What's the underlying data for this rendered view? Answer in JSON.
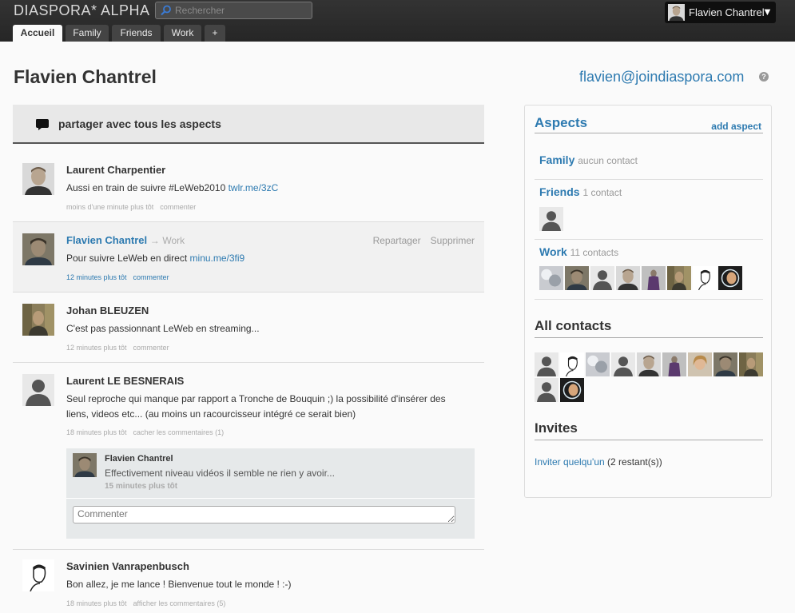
{
  "header": {
    "logo": "DIASPORA* ALPHA",
    "search_placeholder": "Rechercher",
    "user_name": "Flavien Chantrel",
    "user_menu_caret": "▼",
    "tabs": [
      {
        "label": "Accueil",
        "active": true
      },
      {
        "label": "Family",
        "active": false
      },
      {
        "label": "Friends",
        "active": false
      },
      {
        "label": "Work",
        "active": false
      },
      {
        "label": "+",
        "active": false
      }
    ]
  },
  "profile": {
    "name": "Flavien Chantrel",
    "handle": "flavien@joindiaspora.com",
    "help_icon": "?"
  },
  "share": {
    "label": "partager avec tous les aspects",
    "icon": "speech-bubble-icon"
  },
  "posts": [
    {
      "author": "Laurent Charpentier",
      "text": "Aussi en train de suivre #LeWeb2010 ",
      "link": "twlr.me/3zC",
      "time": "moins d'une minute plus tôt",
      "comment_label": "commenter"
    },
    {
      "author": "Flavien Chantrel",
      "aspect_arrow": "→",
      "aspect": "Work",
      "text": "Pour suivre LeWeb en direct ",
      "link": "minu.me/3fi9",
      "time": "12 minutes plus tôt",
      "comment_label": "commenter",
      "actions": [
        "Repartager",
        "Supprimer"
      ]
    },
    {
      "author": "Johan BLEUZEN",
      "text": "C'est pas passionnant LeWeb en streaming...",
      "time": "12 minutes plus tôt",
      "comment_label": "commenter"
    },
    {
      "author": "Laurent LE BESNERAIS",
      "text": "Seul reproche qui manque par rapport a Tronche de Bouquin ;) la possibilité d'insérer des liens, videos etc... (au moins un racourcisseur intégré ce serait bien)",
      "time": "18 minutes plus tôt",
      "comment_label": "cacher les commentaires (1)",
      "comments": [
        {
          "author": "Flavien Chantrel",
          "text": "Effectivement niveau vidéos il semble ne rien y avoir...",
          "time": "15 minutes plus tôt"
        }
      ],
      "comment_placeholder": "Commenter"
    },
    {
      "author": "Savinien Vanrapenbusch",
      "text": "Bon allez, je me lance ! Bienvenue tout le monde ! :-)",
      "time": "18 minutes plus tôt",
      "comment_label": "afficher les commentaires (5)"
    }
  ],
  "sidebar": {
    "aspects_title": "Aspects",
    "add_aspect": "add aspect",
    "aspects": [
      {
        "name": "Family",
        "count": "aucun contact"
      },
      {
        "name": "Friends",
        "count": "1 contact"
      },
      {
        "name": "Work",
        "count": "11 contacts"
      }
    ],
    "all_contacts_title": "All contacts",
    "invites_title": "Invites",
    "invite_link": "Inviter quelqu'un",
    "invite_remaining": " (2 restant(s))"
  },
  "colors": {
    "topbar": "#2b2b2b",
    "link_blue": "#2d7ab0",
    "page_bg": "#fafafa"
  }
}
